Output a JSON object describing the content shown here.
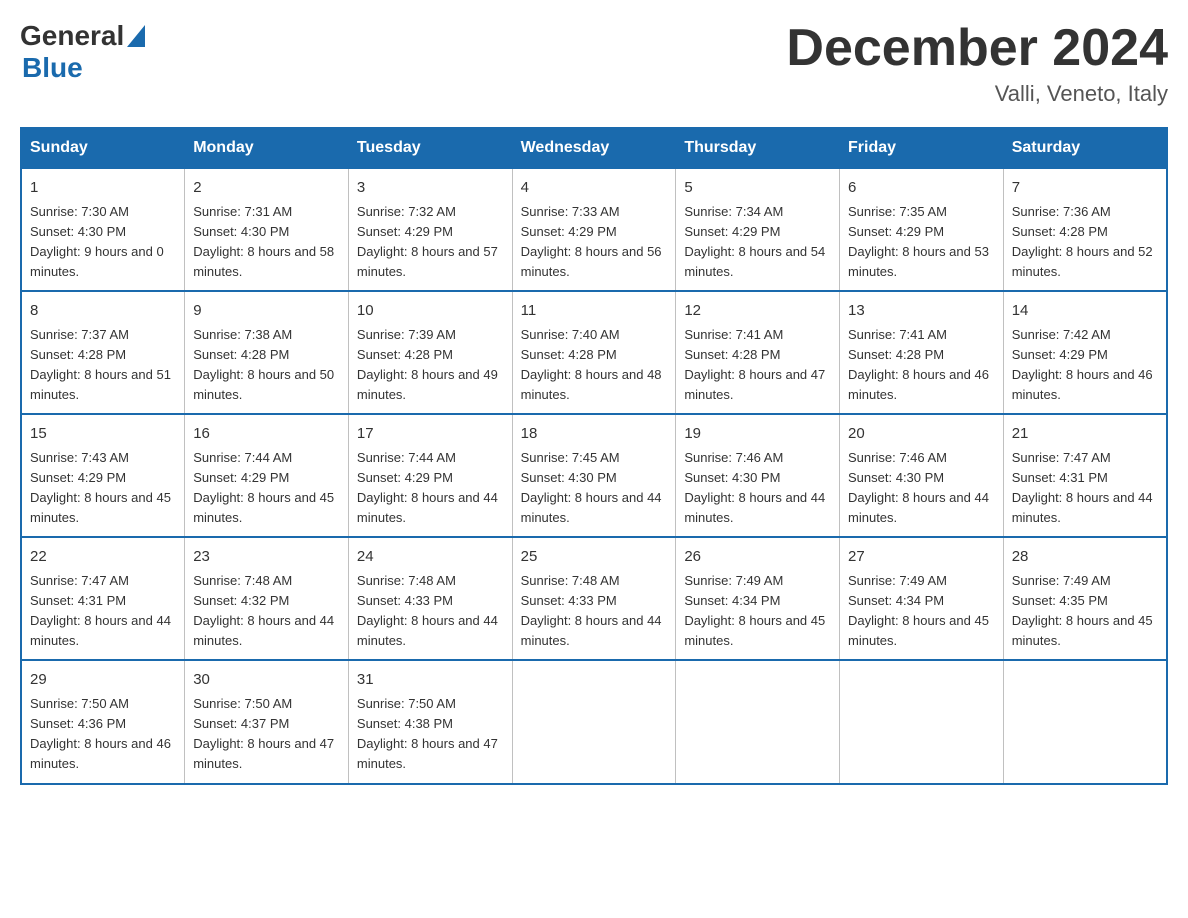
{
  "header": {
    "logo": {
      "general": "General",
      "blue": "Blue"
    },
    "title": "December 2024",
    "location": "Valli, Veneto, Italy"
  },
  "calendar": {
    "days_of_week": [
      "Sunday",
      "Monday",
      "Tuesday",
      "Wednesday",
      "Thursday",
      "Friday",
      "Saturday"
    ],
    "weeks": [
      [
        {
          "day": "1",
          "sunrise": "7:30 AM",
          "sunset": "4:30 PM",
          "daylight": "9 hours and 0 minutes."
        },
        {
          "day": "2",
          "sunrise": "7:31 AM",
          "sunset": "4:30 PM",
          "daylight": "8 hours and 58 minutes."
        },
        {
          "day": "3",
          "sunrise": "7:32 AM",
          "sunset": "4:29 PM",
          "daylight": "8 hours and 57 minutes."
        },
        {
          "day": "4",
          "sunrise": "7:33 AM",
          "sunset": "4:29 PM",
          "daylight": "8 hours and 56 minutes."
        },
        {
          "day": "5",
          "sunrise": "7:34 AM",
          "sunset": "4:29 PM",
          "daylight": "8 hours and 54 minutes."
        },
        {
          "day": "6",
          "sunrise": "7:35 AM",
          "sunset": "4:29 PM",
          "daylight": "8 hours and 53 minutes."
        },
        {
          "day": "7",
          "sunrise": "7:36 AM",
          "sunset": "4:28 PM",
          "daylight": "8 hours and 52 minutes."
        }
      ],
      [
        {
          "day": "8",
          "sunrise": "7:37 AM",
          "sunset": "4:28 PM",
          "daylight": "8 hours and 51 minutes."
        },
        {
          "day": "9",
          "sunrise": "7:38 AM",
          "sunset": "4:28 PM",
          "daylight": "8 hours and 50 minutes."
        },
        {
          "day": "10",
          "sunrise": "7:39 AM",
          "sunset": "4:28 PM",
          "daylight": "8 hours and 49 minutes."
        },
        {
          "day": "11",
          "sunrise": "7:40 AM",
          "sunset": "4:28 PM",
          "daylight": "8 hours and 48 minutes."
        },
        {
          "day": "12",
          "sunrise": "7:41 AM",
          "sunset": "4:28 PM",
          "daylight": "8 hours and 47 minutes."
        },
        {
          "day": "13",
          "sunrise": "7:41 AM",
          "sunset": "4:28 PM",
          "daylight": "8 hours and 46 minutes."
        },
        {
          "day": "14",
          "sunrise": "7:42 AM",
          "sunset": "4:29 PM",
          "daylight": "8 hours and 46 minutes."
        }
      ],
      [
        {
          "day": "15",
          "sunrise": "7:43 AM",
          "sunset": "4:29 PM",
          "daylight": "8 hours and 45 minutes."
        },
        {
          "day": "16",
          "sunrise": "7:44 AM",
          "sunset": "4:29 PM",
          "daylight": "8 hours and 45 minutes."
        },
        {
          "day": "17",
          "sunrise": "7:44 AM",
          "sunset": "4:29 PM",
          "daylight": "8 hours and 44 minutes."
        },
        {
          "day": "18",
          "sunrise": "7:45 AM",
          "sunset": "4:30 PM",
          "daylight": "8 hours and 44 minutes."
        },
        {
          "day": "19",
          "sunrise": "7:46 AM",
          "sunset": "4:30 PM",
          "daylight": "8 hours and 44 minutes."
        },
        {
          "day": "20",
          "sunrise": "7:46 AM",
          "sunset": "4:30 PM",
          "daylight": "8 hours and 44 minutes."
        },
        {
          "day": "21",
          "sunrise": "7:47 AM",
          "sunset": "4:31 PM",
          "daylight": "8 hours and 44 minutes."
        }
      ],
      [
        {
          "day": "22",
          "sunrise": "7:47 AM",
          "sunset": "4:31 PM",
          "daylight": "8 hours and 44 minutes."
        },
        {
          "day": "23",
          "sunrise": "7:48 AM",
          "sunset": "4:32 PM",
          "daylight": "8 hours and 44 minutes."
        },
        {
          "day": "24",
          "sunrise": "7:48 AM",
          "sunset": "4:33 PM",
          "daylight": "8 hours and 44 minutes."
        },
        {
          "day": "25",
          "sunrise": "7:48 AM",
          "sunset": "4:33 PM",
          "daylight": "8 hours and 44 minutes."
        },
        {
          "day": "26",
          "sunrise": "7:49 AM",
          "sunset": "4:34 PM",
          "daylight": "8 hours and 45 minutes."
        },
        {
          "day": "27",
          "sunrise": "7:49 AM",
          "sunset": "4:34 PM",
          "daylight": "8 hours and 45 minutes."
        },
        {
          "day": "28",
          "sunrise": "7:49 AM",
          "sunset": "4:35 PM",
          "daylight": "8 hours and 45 minutes."
        }
      ],
      [
        {
          "day": "29",
          "sunrise": "7:50 AM",
          "sunset": "4:36 PM",
          "daylight": "8 hours and 46 minutes."
        },
        {
          "day": "30",
          "sunrise": "7:50 AM",
          "sunset": "4:37 PM",
          "daylight": "8 hours and 47 minutes."
        },
        {
          "day": "31",
          "sunrise": "7:50 AM",
          "sunset": "4:38 PM",
          "daylight": "8 hours and 47 minutes."
        },
        null,
        null,
        null,
        null
      ]
    ]
  }
}
